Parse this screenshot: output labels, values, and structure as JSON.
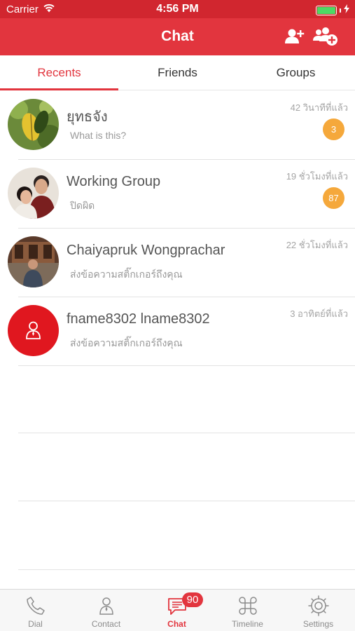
{
  "status_bar": {
    "carrier": "Carrier",
    "time": "4:56 PM",
    "wifi_icon": "wifi-icon",
    "battery_level": 1.0,
    "battery_color": "#4cd964"
  },
  "header": {
    "title": "Chat",
    "add_friend_icon": "add-friend-icon",
    "create_group_icon": "create-group-icon",
    "color": "#e2353e"
  },
  "tabs": [
    {
      "label": "Recents",
      "active": true
    },
    {
      "label": "Friends",
      "active": false
    },
    {
      "label": "Groups",
      "active": false
    }
  ],
  "chats": [
    {
      "name": "ยุทธจัง",
      "message": "What is this?",
      "time": "42 วินาทีที่แล้ว",
      "badge": "3",
      "avatar": "photo-leaf"
    },
    {
      "name": "Working Group",
      "message": "ปิดผิด",
      "time": "19 ชั่วโมงที่แล้ว",
      "badge": "87",
      "avatar": "photo-couple"
    },
    {
      "name": "Chaiyapruk Wongprachar",
      "message": "ส่งข้อความสติ๊กเกอร์ถึงคุณ",
      "time": "22 ชั่วโมงที่แล้ว",
      "badge": "",
      "avatar": "photo-person"
    },
    {
      "name": "fname8302 lname8302",
      "message": "ส่งข้อความสติ๊กเกอร์ถึงคุณ",
      "time": "3 อาทิตย์ที่แล้ว",
      "badge": "",
      "avatar": "default-user-icon"
    }
  ],
  "tab_bar": {
    "items": [
      {
        "label": "Dial",
        "icon": "phone-icon",
        "active": false
      },
      {
        "label": "Contact",
        "icon": "contact-icon",
        "active": false
      },
      {
        "label": "Chat",
        "icon": "chat-icon",
        "active": true,
        "badge": "90"
      },
      {
        "label": "Timeline",
        "icon": "command-icon",
        "active": false
      },
      {
        "label": "Settings",
        "icon": "gear-icon",
        "active": false
      }
    ]
  },
  "colors": {
    "accent": "#e2353e",
    "badge": "#f5a83b",
    "inactive_tab": "#8c8c8c"
  }
}
